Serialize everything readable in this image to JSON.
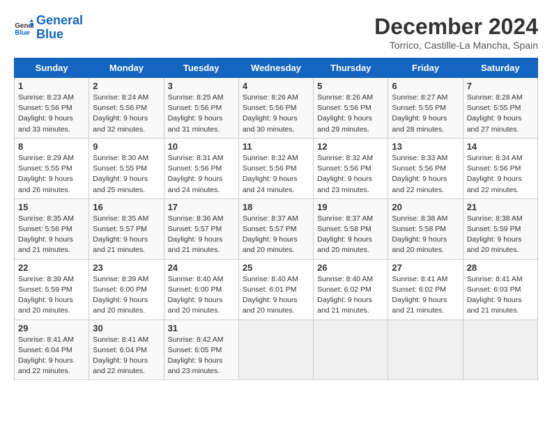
{
  "logo": {
    "text_general": "General",
    "text_blue": "Blue"
  },
  "title": "December 2024",
  "subtitle": "Torrico, Castille-La Mancha, Spain",
  "header_days": [
    "Sunday",
    "Monday",
    "Tuesday",
    "Wednesday",
    "Thursday",
    "Friday",
    "Saturday"
  ],
  "weeks": [
    [
      {
        "day": "1",
        "sunrise": "8:23 AM",
        "sunset": "5:56 PM",
        "daylight": "9 hours and 33 minutes."
      },
      {
        "day": "2",
        "sunrise": "8:24 AM",
        "sunset": "5:56 PM",
        "daylight": "9 hours and 32 minutes."
      },
      {
        "day": "3",
        "sunrise": "8:25 AM",
        "sunset": "5:56 PM",
        "daylight": "9 hours and 31 minutes."
      },
      {
        "day": "4",
        "sunrise": "8:26 AM",
        "sunset": "5:56 PM",
        "daylight": "9 hours and 30 minutes."
      },
      {
        "day": "5",
        "sunrise": "8:26 AM",
        "sunset": "5:56 PM",
        "daylight": "9 hours and 29 minutes."
      },
      {
        "day": "6",
        "sunrise": "8:27 AM",
        "sunset": "5:55 PM",
        "daylight": "9 hours and 28 minutes."
      },
      {
        "day": "7",
        "sunrise": "8:28 AM",
        "sunset": "5:55 PM",
        "daylight": "9 hours and 27 minutes."
      }
    ],
    [
      {
        "day": "8",
        "sunrise": "8:29 AM",
        "sunset": "5:55 PM",
        "daylight": "9 hours and 26 minutes."
      },
      {
        "day": "9",
        "sunrise": "8:30 AM",
        "sunset": "5:55 PM",
        "daylight": "9 hours and 25 minutes."
      },
      {
        "day": "10",
        "sunrise": "8:31 AM",
        "sunset": "5:56 PM",
        "daylight": "9 hours and 24 minutes."
      },
      {
        "day": "11",
        "sunrise": "8:32 AM",
        "sunset": "5:56 PM",
        "daylight": "9 hours and 24 minutes."
      },
      {
        "day": "12",
        "sunrise": "8:32 AM",
        "sunset": "5:56 PM",
        "daylight": "9 hours and 23 minutes."
      },
      {
        "day": "13",
        "sunrise": "8:33 AM",
        "sunset": "5:56 PM",
        "daylight": "9 hours and 22 minutes."
      },
      {
        "day": "14",
        "sunrise": "8:34 AM",
        "sunset": "5:56 PM",
        "daylight": "9 hours and 22 minutes."
      }
    ],
    [
      {
        "day": "15",
        "sunrise": "8:35 AM",
        "sunset": "5:56 PM",
        "daylight": "9 hours and 21 minutes."
      },
      {
        "day": "16",
        "sunrise": "8:35 AM",
        "sunset": "5:57 PM",
        "daylight": "9 hours and 21 minutes."
      },
      {
        "day": "17",
        "sunrise": "8:36 AM",
        "sunset": "5:57 PM",
        "daylight": "9 hours and 21 minutes."
      },
      {
        "day": "18",
        "sunrise": "8:37 AM",
        "sunset": "5:57 PM",
        "daylight": "9 hours and 20 minutes."
      },
      {
        "day": "19",
        "sunrise": "8:37 AM",
        "sunset": "5:58 PM",
        "daylight": "9 hours and 20 minutes."
      },
      {
        "day": "20",
        "sunrise": "8:38 AM",
        "sunset": "5:58 PM",
        "daylight": "9 hours and 20 minutes."
      },
      {
        "day": "21",
        "sunrise": "8:38 AM",
        "sunset": "5:59 PM",
        "daylight": "9 hours and 20 minutes."
      }
    ],
    [
      {
        "day": "22",
        "sunrise": "8:39 AM",
        "sunset": "5:59 PM",
        "daylight": "9 hours and 20 minutes."
      },
      {
        "day": "23",
        "sunrise": "8:39 AM",
        "sunset": "6:00 PM",
        "daylight": "9 hours and 20 minutes."
      },
      {
        "day": "24",
        "sunrise": "8:40 AM",
        "sunset": "6:00 PM",
        "daylight": "9 hours and 20 minutes."
      },
      {
        "day": "25",
        "sunrise": "8:40 AM",
        "sunset": "6:01 PM",
        "daylight": "9 hours and 20 minutes."
      },
      {
        "day": "26",
        "sunrise": "8:40 AM",
        "sunset": "6:02 PM",
        "daylight": "9 hours and 21 minutes."
      },
      {
        "day": "27",
        "sunrise": "8:41 AM",
        "sunset": "6:02 PM",
        "daylight": "9 hours and 21 minutes."
      },
      {
        "day": "28",
        "sunrise": "8:41 AM",
        "sunset": "6:03 PM",
        "daylight": "9 hours and 21 minutes."
      }
    ],
    [
      {
        "day": "29",
        "sunrise": "8:41 AM",
        "sunset": "6:04 PM",
        "daylight": "9 hours and 22 minutes."
      },
      {
        "day": "30",
        "sunrise": "8:41 AM",
        "sunset": "6:04 PM",
        "daylight": "9 hours and 22 minutes."
      },
      {
        "day": "31",
        "sunrise": "8:42 AM",
        "sunset": "6:05 PM",
        "daylight": "9 hours and 23 minutes."
      },
      null,
      null,
      null,
      null
    ]
  ]
}
